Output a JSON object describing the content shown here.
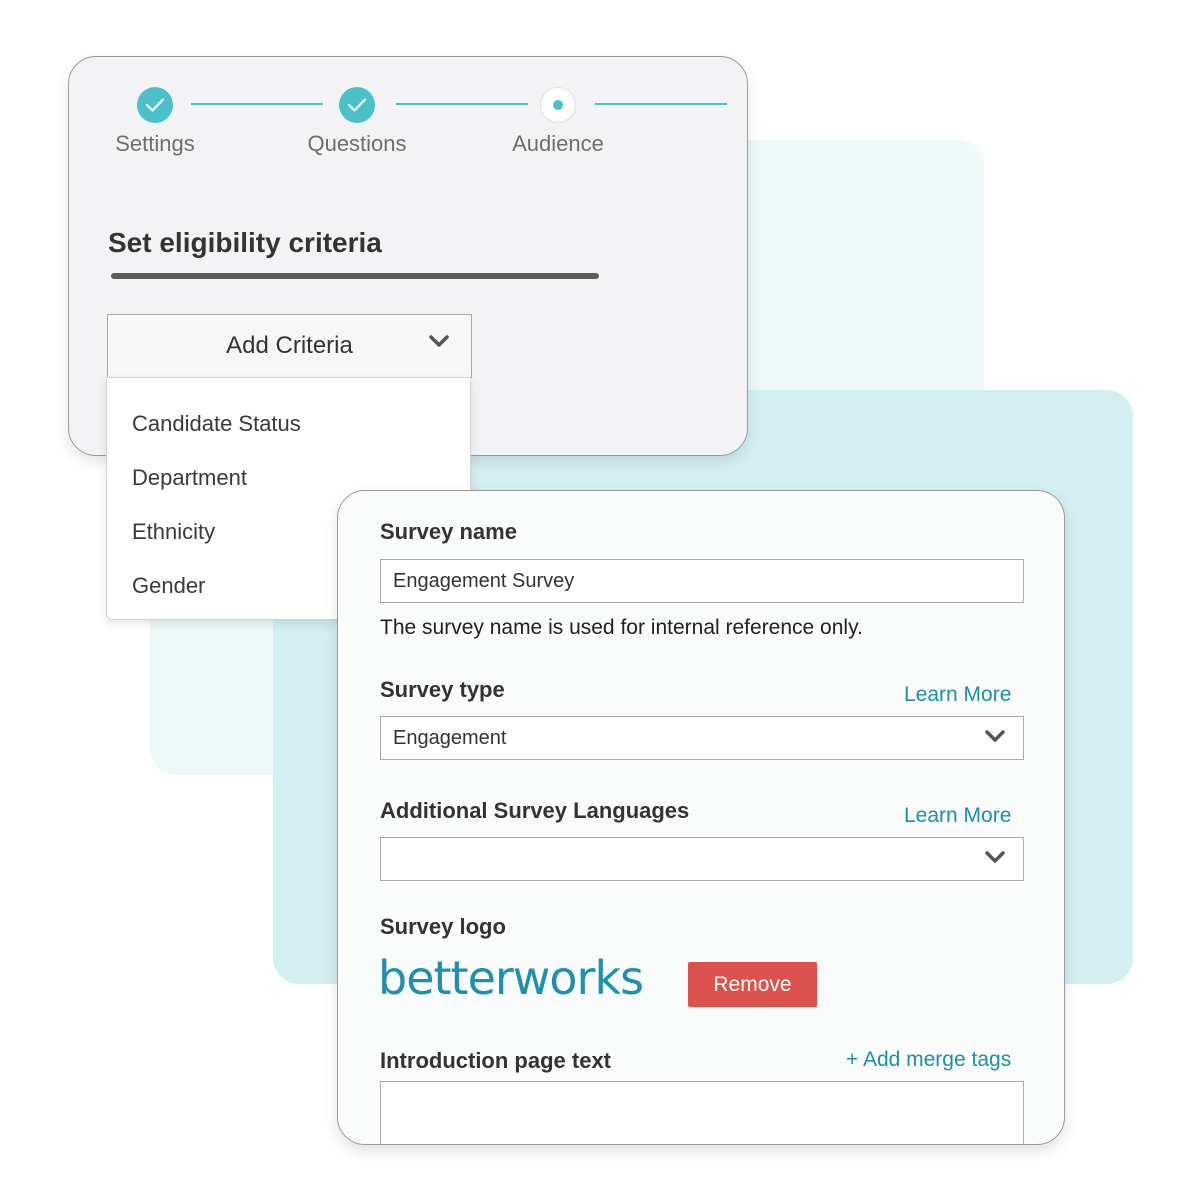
{
  "stepper": {
    "steps": [
      {
        "label": "Settings",
        "state": "complete"
      },
      {
        "label": "Questions",
        "state": "complete"
      },
      {
        "label": "Audience",
        "state": "current"
      }
    ]
  },
  "criteria": {
    "title": "Set eligibility criteria",
    "add_button_label": "Add Criteria",
    "options": [
      "Candidate Status",
      "Department",
      "Ethnicity",
      "Gender"
    ]
  },
  "survey_form": {
    "name_label": "Survey name",
    "name_value": "Engagement Survey",
    "name_help": "The survey name is used for internal reference only.",
    "type_label": "Survey type",
    "type_learn_more": "Learn More",
    "type_value": "Engagement",
    "languages_label": "Additional Survey Languages",
    "languages_learn_more": "Learn More",
    "languages_value": "",
    "logo_label": "Survey logo",
    "logo_text": "betterworks",
    "remove_label": "Remove",
    "intro_label": "Introduction page text",
    "merge_tags_label": "+ Add merge tags"
  },
  "colors": {
    "accent_teal": "#4cc0c8",
    "link_blue": "#1e8fa8",
    "remove_red": "#dd524c",
    "backdrop_light": "#eef8f9",
    "backdrop_teal": "#d3eff2"
  }
}
